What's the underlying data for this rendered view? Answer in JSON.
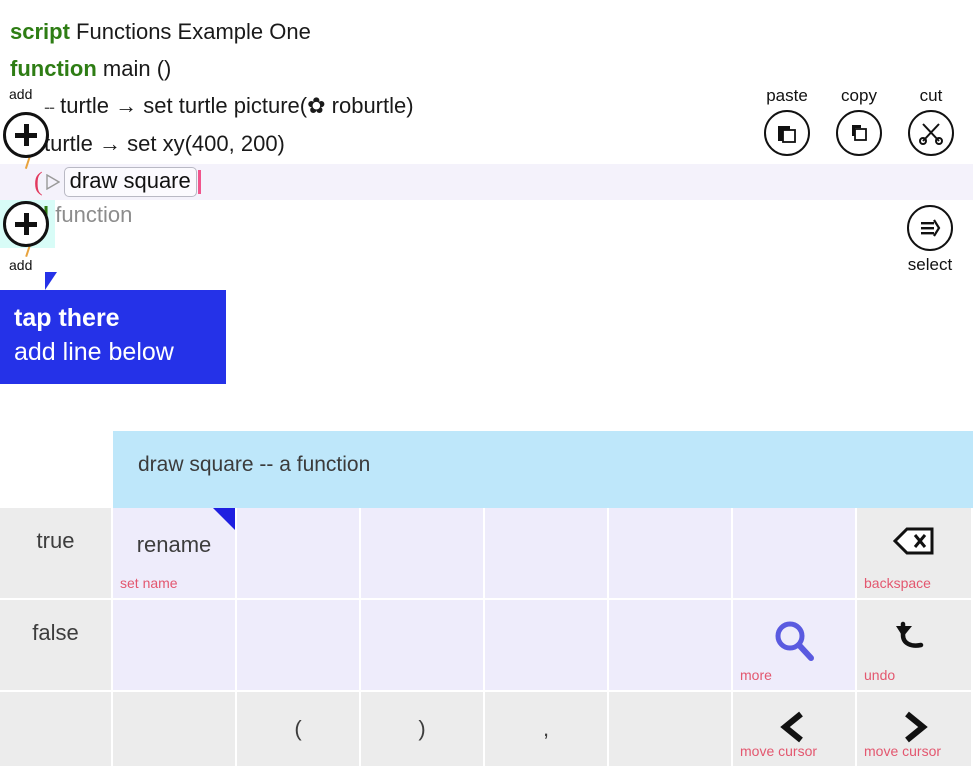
{
  "editor": {
    "line_script": {
      "keyword": "script",
      "text": "Functions Example One"
    },
    "line_function": {
      "keyword": "function",
      "text": "main ()"
    },
    "line_picture": {
      "comment_marker": "--",
      "text": "turtle → set turtle picture(✿ roburtle)"
    },
    "line_xy": {
      "text": "turtle → set xy(400, 200)"
    },
    "selected_line": {
      "brace": "(",
      "play_icon": "play-triangle-icon",
      "value": "draw square"
    },
    "line_end": {
      "keyword": "end",
      "rest": "function"
    },
    "add_button_top": {
      "label": "add",
      "icon": "plus-icon"
    },
    "add_button_bottom": {
      "label": "add",
      "icon": "plus-icon"
    }
  },
  "tooltip": {
    "line1": "tap there",
    "line2": "add line below",
    "color": "#2532e8"
  },
  "toolbar": [
    {
      "label": "paste",
      "icon": "paste-icon"
    },
    {
      "label": "copy",
      "icon": "copy-icon"
    },
    {
      "label": "cut",
      "icon": "scissors-icon"
    }
  ],
  "select_tool": {
    "label": "select",
    "icon": "select-lines-icon"
  },
  "panel": {
    "hint": "draw square -- a function",
    "hint_bg": "#bee7fa"
  },
  "keypad": {
    "rows": [
      [
        {
          "main": "true",
          "sub": "",
          "style": "gray",
          "corner": false,
          "glyph": ""
        },
        {
          "main": "rename",
          "sub": "set name",
          "style": "lav",
          "corner": true,
          "glyph": ""
        },
        {
          "main": "",
          "sub": "",
          "style": "lav",
          "corner": false,
          "glyph": ""
        },
        {
          "main": "",
          "sub": "",
          "style": "lav",
          "corner": false,
          "glyph": ""
        },
        {
          "main": "",
          "sub": "",
          "style": "lav",
          "corner": false,
          "glyph": ""
        },
        {
          "main": "",
          "sub": "",
          "style": "lav",
          "corner": false,
          "glyph": ""
        },
        {
          "main": "",
          "sub": "",
          "style": "lav",
          "corner": false,
          "glyph": ""
        },
        {
          "main": "",
          "sub": "backspace",
          "style": "gray",
          "corner": false,
          "glyph": "backspace-icon"
        }
      ],
      [
        {
          "main": "false",
          "sub": "",
          "style": "gray",
          "corner": false,
          "glyph": ""
        },
        {
          "main": "",
          "sub": "",
          "style": "lav",
          "corner": false,
          "glyph": ""
        },
        {
          "main": "",
          "sub": "",
          "style": "lav",
          "corner": false,
          "glyph": ""
        },
        {
          "main": "",
          "sub": "",
          "style": "lav",
          "corner": false,
          "glyph": ""
        },
        {
          "main": "",
          "sub": "",
          "style": "lav",
          "corner": false,
          "glyph": ""
        },
        {
          "main": "",
          "sub": "",
          "style": "lav",
          "corner": false,
          "glyph": ""
        },
        {
          "main": "",
          "sub": "more",
          "style": "lav",
          "corner": false,
          "glyph": "search-icon"
        },
        {
          "main": "",
          "sub": "undo",
          "style": "gray",
          "corner": false,
          "glyph": "undo-icon"
        }
      ],
      [
        {
          "main": "",
          "sub": "",
          "style": "gray",
          "corner": false,
          "glyph": ""
        },
        {
          "main": "",
          "sub": "",
          "style": "gray",
          "corner": false,
          "glyph": ""
        },
        {
          "main": "(",
          "sub": "",
          "style": "gray",
          "corner": false,
          "glyph": ""
        },
        {
          "main": ")",
          "sub": "",
          "style": "gray",
          "corner": false,
          "glyph": ""
        },
        {
          "main": ",",
          "sub": "",
          "style": "gray",
          "corner": false,
          "glyph": ""
        },
        {
          "main": "",
          "sub": "",
          "style": "gray",
          "corner": false,
          "glyph": ""
        },
        {
          "main": "",
          "sub": "move cursor",
          "style": "gray",
          "corner": false,
          "glyph": "cursor-left-icon"
        },
        {
          "main": "",
          "sub": "move cursor",
          "style": "gray",
          "corner": false,
          "glyph": "cursor-right-icon"
        }
      ]
    ]
  },
  "colors": {
    "keyword_green": "#2e7d14",
    "accent_blue": "#2532e8",
    "hint_blue": "#bee7fa",
    "key_lavender": "#eeecfb",
    "key_gray": "#ececec",
    "sub_label_red": "#e3576f",
    "caret_pink": "#f0558c"
  }
}
